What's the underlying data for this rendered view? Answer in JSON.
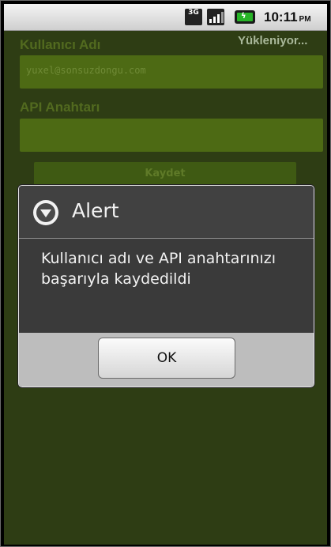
{
  "status_bar": {
    "network": "3G",
    "time": "10:11",
    "ampm": "PM"
  },
  "app": {
    "username_label": "Kullanıcı Adı",
    "username_value": "yuxel@sonsuzdongu.com",
    "api_key_label": "API Anahtarı",
    "api_key_value": "",
    "save_button": "Kaydet",
    "loading_text": "Yükleniyor..."
  },
  "dialog": {
    "title": "Alert",
    "message": "Kullanıcı adı ve API anahtarınızı başarıyla kaydedildi",
    "ok_button": "OK"
  },
  "colors": {
    "app_background": "#2e3d14",
    "dialog_background": "#414141",
    "dialog_footer": "#bdbdbd"
  },
  "icons": [
    "network-3g-icon",
    "signal-icon",
    "battery-icon",
    "alert-icon"
  ]
}
